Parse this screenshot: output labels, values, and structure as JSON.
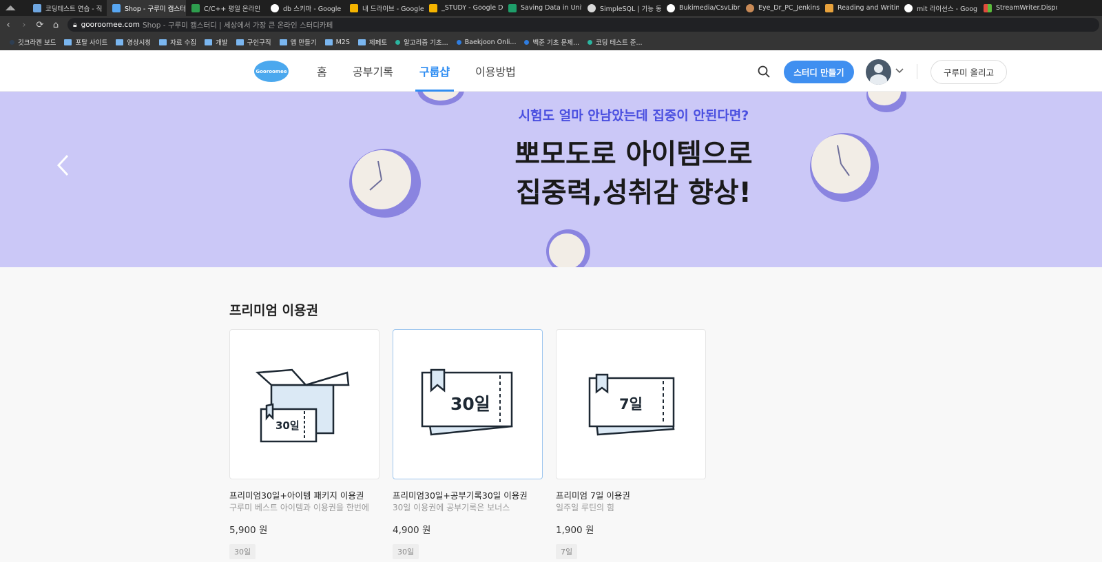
{
  "browser": {
    "tabs": [
      {
        "label": "코딩테스트 연습 - 직",
        "color": "#6ea6e0"
      },
      {
        "label": "Shop - 구루미 캠스터",
        "color": "#58a7f3"
      },
      {
        "label": "C/C++ 평일 온라인 ",
        "color": "#2e9e4e"
      },
      {
        "label": "db 스키마 - Google ",
        "color": "#ffffff"
      },
      {
        "label": "내 드라이브 - Google",
        "color": "#f5b400"
      },
      {
        "label": "_STUDY - Google Dri",
        "color": "#f5b400"
      },
      {
        "label": "Saving Data in Unity:",
        "color": "#1e9e6a"
      },
      {
        "label": "SimpleSQL | 기능 동",
        "color": "#d8d8d8"
      },
      {
        "label": "Bukimedia/CsvLibrary",
        "color": "#ffffff"
      },
      {
        "label": "Eye_Dr_PC_Jenkins [E",
        "color": "#c98a56"
      },
      {
        "label": "Reading and Writing",
        "color": "#e8a23c"
      },
      {
        "label": "mit 라이선스 - Goog",
        "color": "#ffffff"
      },
      {
        "label": "StreamWriter.Dispose",
        "color": "#e04b3c"
      }
    ],
    "url_host": "gooroomee.com",
    "url_rest": "Shop - 구루미 캠스터디  |  세상에서 가장 큰 온라인 스터디카페",
    "bookmarks": [
      {
        "label": "깃크라켄 보드",
        "kind": "dot",
        "color": "#2e3e52"
      },
      {
        "label": "포탈 사이트",
        "kind": "folder"
      },
      {
        "label": "영상시청",
        "kind": "folder"
      },
      {
        "label": "자료 수집",
        "kind": "folder"
      },
      {
        "label": "개발",
        "kind": "folder"
      },
      {
        "label": "구인구직",
        "kind": "folder"
      },
      {
        "label": "앱 만들기",
        "kind": "folder"
      },
      {
        "label": "M2S",
        "kind": "folder"
      },
      {
        "label": "제페토",
        "kind": "folder"
      },
      {
        "label": "알고리즘 기초...",
        "kind": "dot",
        "color": "#2bb5a0"
      },
      {
        "label": "Baekjoon Onli...",
        "kind": "dot",
        "color": "#2f7de0"
      },
      {
        "label": "백준 기초 문제...",
        "kind": "dot",
        "color": "#2f7de0"
      },
      {
        "label": "코딩 테스트 준...",
        "kind": "dot",
        "color": "#2bb5a0"
      }
    ]
  },
  "header": {
    "logo": "Gooroomee",
    "menu": [
      {
        "label": "홈",
        "active": false
      },
      {
        "label": "공부기록",
        "active": false
      },
      {
        "label": "구룹샵",
        "active": true
      },
      {
        "label": "이용방법",
        "active": false
      }
    ],
    "create_study": "스터디 만들기",
    "upload": "구루미 올리고"
  },
  "banner": {
    "subtitle": "시험도 얼마 안남았는데 집중이 안된다면?",
    "title_line1": "뽀모도로 아이템으로",
    "title_line2": "집중력,성취감 향상!"
  },
  "section": {
    "title": "프리미엄 이용권"
  },
  "products": [
    {
      "name": "프리미엄30일+아이템 패키지 이용권",
      "desc": "구루미 베스트 아이템과 이용권을 한번에",
      "price": "5,900 원",
      "tag": "30일",
      "ticket": "30일"
    },
    {
      "name": "프리미엄30일+공부기록30일 이용권",
      "desc": "30일 이용권에 공부기록은 보너스",
      "price": "4,900 원",
      "tag": "30일",
      "ticket": "30일"
    },
    {
      "name": "프리미엄 7일 이용권",
      "desc": "일주일 루틴의 힘",
      "price": "1,900 원",
      "tag": "7일",
      "ticket": "7일"
    }
  ],
  "colors": {
    "accent": "#3f8ff0",
    "banner_bg": "#cbc8f7",
    "banner_sub": "#4a4fe0"
  }
}
